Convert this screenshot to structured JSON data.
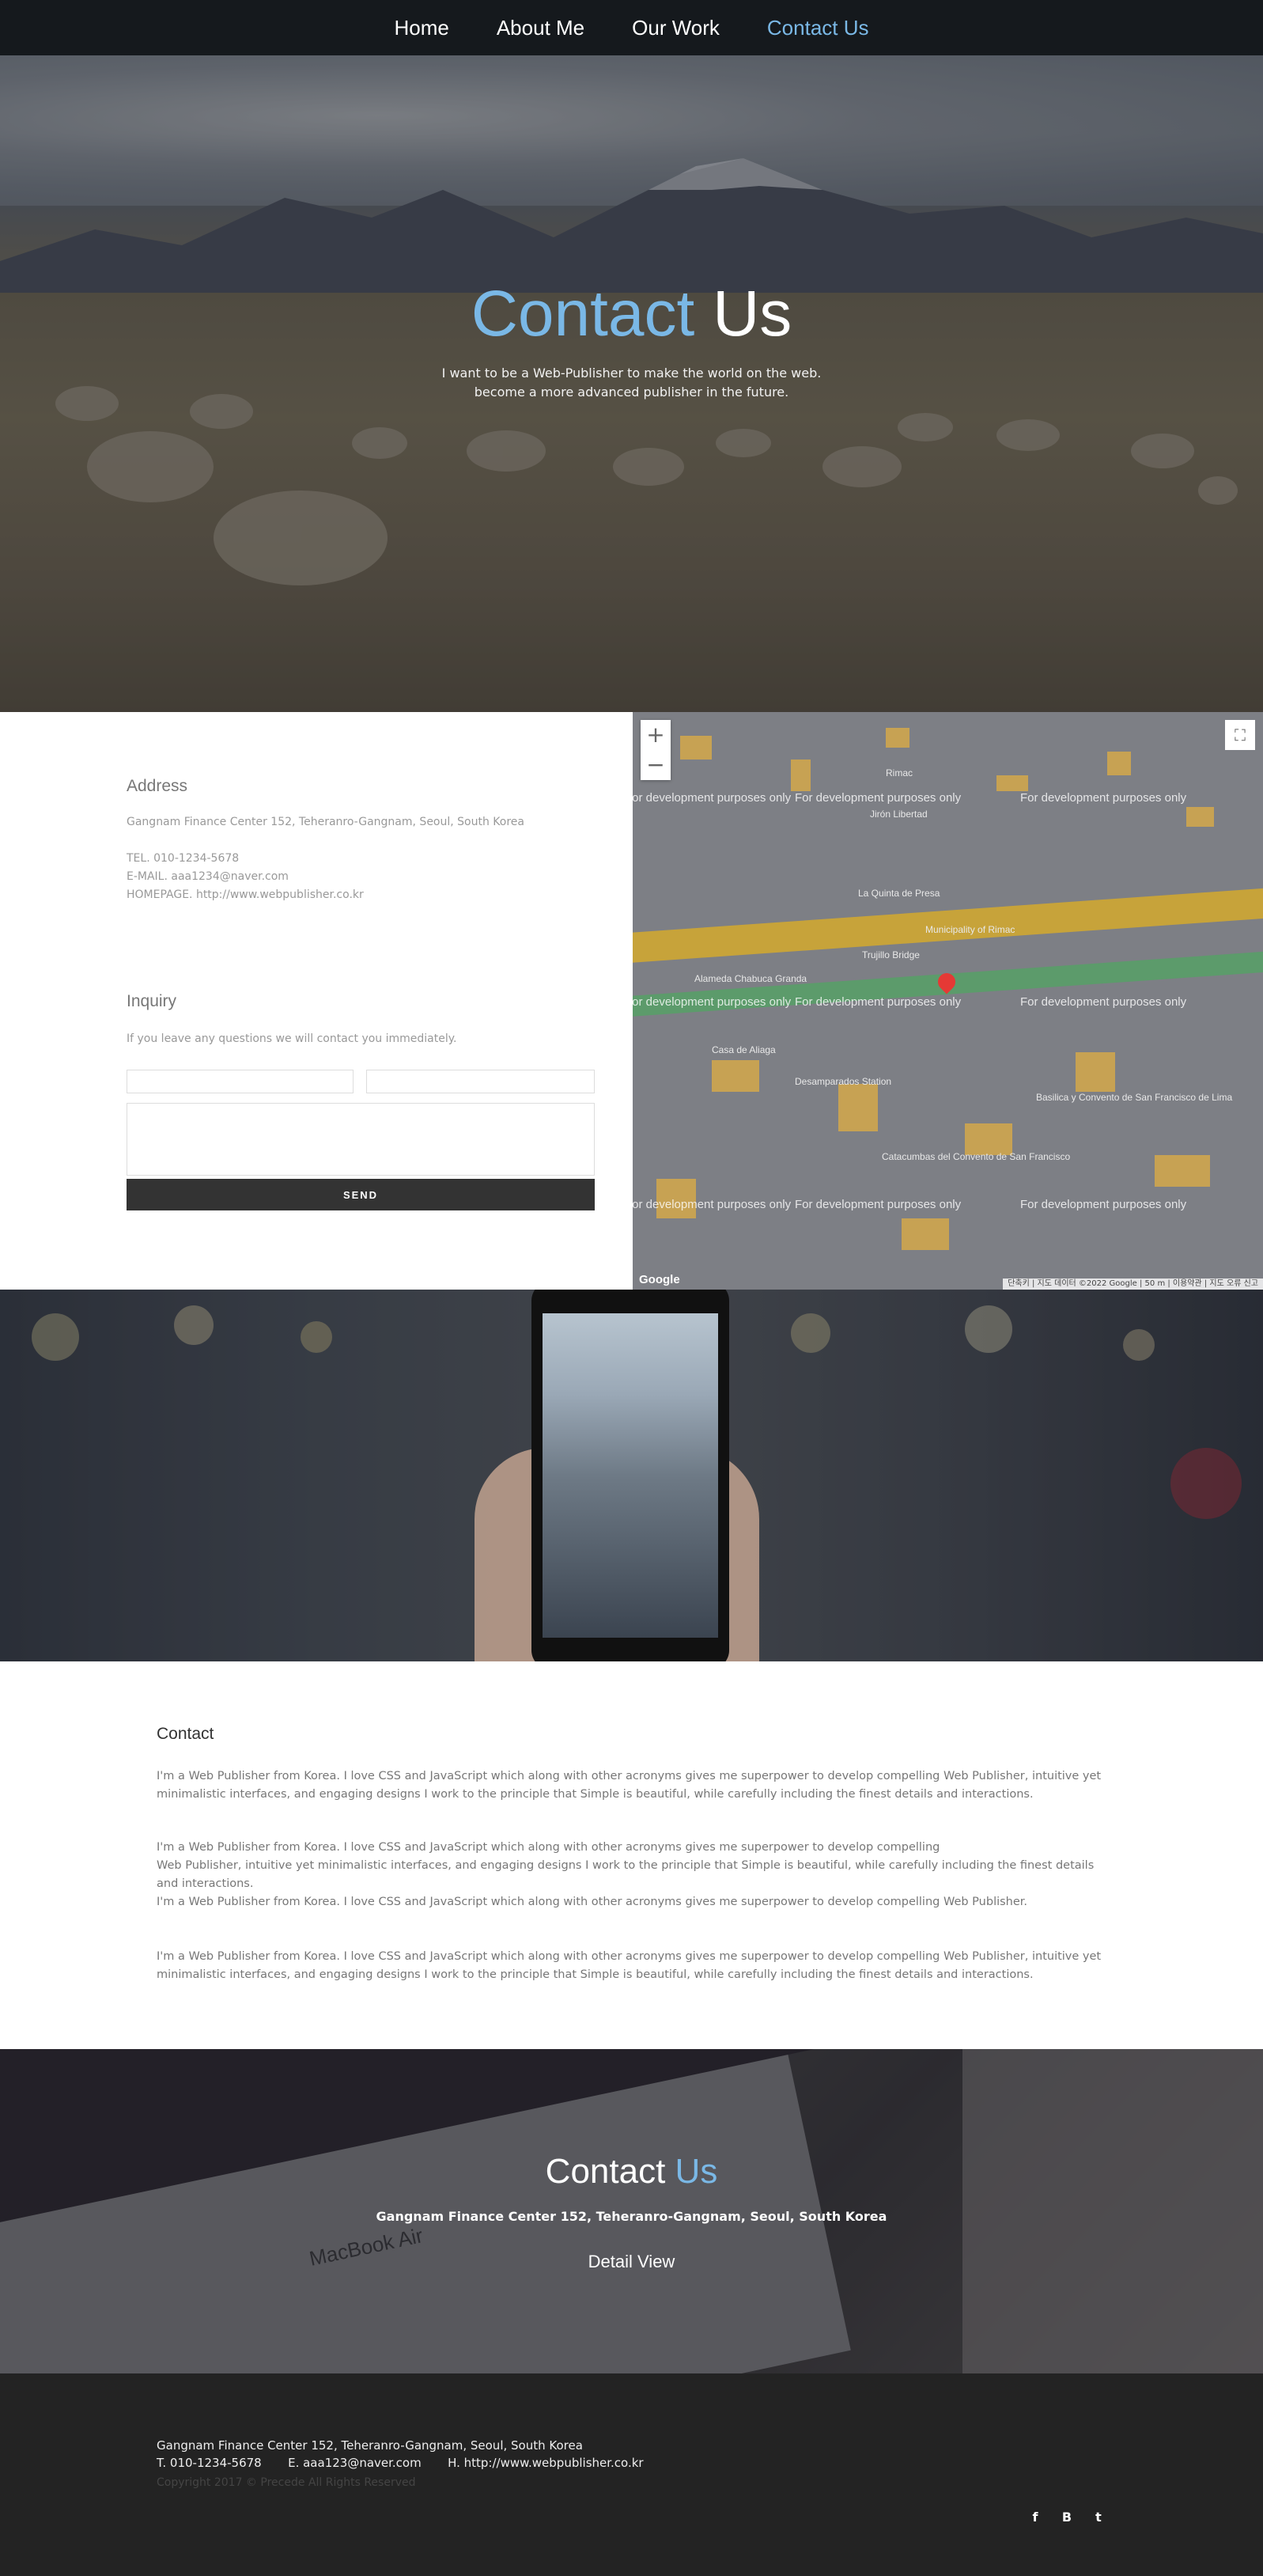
{
  "nav": {
    "items": [
      {
        "label": "Home"
      },
      {
        "label": "About Me"
      },
      {
        "label": "Our Work"
      },
      {
        "label": "Contact Us"
      }
    ],
    "active_color": "#7ab8e6"
  },
  "hero": {
    "title_accent": "Contact",
    "title_rest": "Us",
    "sub_line1": "I want to be a Web-Publisher to make the world on the web.",
    "sub_line2": "become a more advanced publisher in the future."
  },
  "address": {
    "heading": "Address",
    "location": "Gangnam Finance Center 152, Teheranro-Gangnam, Seoul, South Korea",
    "tel": "TEL. 010-1234-5678",
    "email": "E-MAIL. aaa1234@naver.com",
    "homepage": "HOMEPAGE. http://www.webpublisher.co.kr"
  },
  "inquiry": {
    "heading": "Inquiry",
    "desc": "If you leave any questions we will contact you immediately.",
    "send_label": "SEND"
  },
  "map": {
    "watermark": "For development purposes only",
    "zoom_in": "+",
    "zoom_out": "−",
    "fullscreen_icon": "fullscreen-icon",
    "labels": {
      "jiron_libertad": "Jirón Libertad",
      "rimac": "Rimac",
      "trujillo": "Trujillo Bridge",
      "desamparados": "Desamparados Station",
      "casa_aliaga": "Casa de Aliaga",
      "catacumbas": "Catacumbas del Convento de San Francisco",
      "basilica": "Basilica y Convento de San Francisco de Lima",
      "municipality": "Municipality of Rimac",
      "alameda": "Alameda Chabuca Granda",
      "quinta": "La Quinta de Presa",
      "google": "Google",
      "attribution": "단축키 | 지도 데이터 ©2022 Google | 50 m | 이용약관 | 지도 오류 신고"
    }
  },
  "about": {
    "heading": "Contact",
    "p1": "I'm a Web Publisher from Korea. I love CSS and JavaScript which along with other acronyms gives me superpower to develop compelling Web Publisher, intuitive yet minimalistic interfaces, and engaging designs I work to the principle that Simple is beautiful, while carefully including the finest details and interactions.",
    "p2a": "I'm a Web Publisher from Korea. I love CSS and JavaScript which along with other acronyms gives me superpower to develop compelling",
    "p2b": "Web Publisher, intuitive yet minimalistic interfaces, and engaging designs I work to the principle that Simple is beautiful, while carefully including the finest details and interactions.",
    "p2c": "I'm a Web Publisher from Korea. I love CSS and JavaScript which along with other acronyms gives me superpower to develop compelling Web Publisher.",
    "p3": "I'm a Web Publisher from Korea. I love CSS and JavaScript which along with other acronyms gives me superpower to develop compelling Web Publisher, intuitive yet minimalistic interfaces, and engaging designs I work to the principle that Simple is beautiful, while carefully including the finest details and interactions."
  },
  "banner": {
    "title_main": "Contact",
    "title_accent": "Us",
    "address": "Gangnam Finance Center 152, Teheranro-Gangnam, Seoul, South Korea",
    "detail": "Detail View",
    "laptop_text": "MacBook Air"
  },
  "footer": {
    "line1": "Gangnam Finance Center 152, Teheranro-Gangnam, Seoul, South Korea",
    "line2": "T. 010-1234-5678       E. aaa123@naver.com       H. http://www.webpublisher.co.kr",
    "copyright": "Copyright 2017 © Precede All Rights Reserved",
    "social": [
      {
        "icon": "facebook-icon",
        "glyph": "f"
      },
      {
        "icon": "blogger-icon",
        "glyph": "B"
      },
      {
        "icon": "twitter-icon",
        "glyph": "t"
      }
    ]
  }
}
